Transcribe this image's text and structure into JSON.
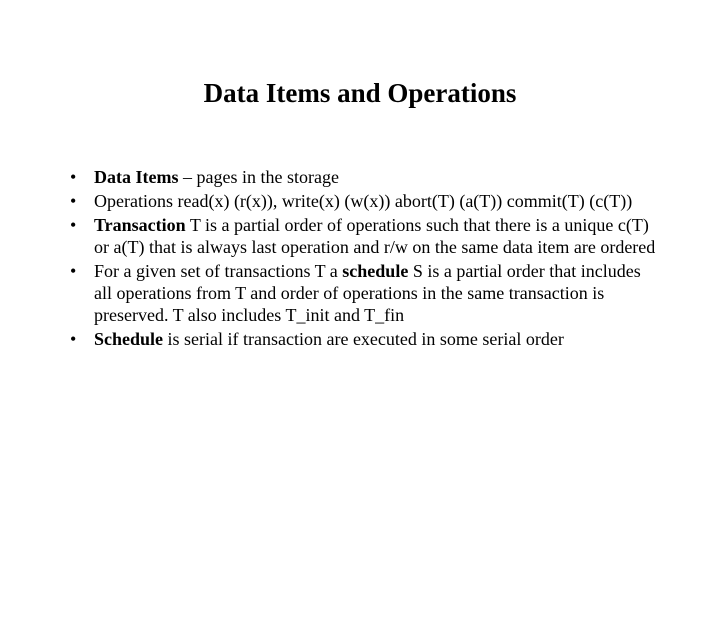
{
  "title": "Data Items and Operations",
  "bullets": [
    {
      "segments": [
        {
          "text": "Data Items",
          "bold": true
        },
        {
          "text": " – pages in the storage",
          "bold": false
        }
      ]
    },
    {
      "segments": [
        {
          "text": "Operations read(x) (r(x)), write(x) (w(x)) abort(T) (a(T)) commit(T) (c(T))",
          "bold": false
        }
      ]
    },
    {
      "segments": [
        {
          "text": "Transaction",
          "bold": true
        },
        {
          "text": " T is a partial order of operations such that there is a unique c(T) or a(T) that is always last operation and r/w on the same data item are ordered",
          "bold": false
        }
      ]
    },
    {
      "segments": [
        {
          "text": "For a given set of transactions T a ",
          "bold": false
        },
        {
          "text": "schedule",
          "bold": true
        },
        {
          "text": "  S  is a partial order that includes all operations from T and order of operations in the same transaction is preserved. T also includes T_init and T_fin",
          "bold": false
        }
      ]
    },
    {
      "segments": [
        {
          "text": "Schedule",
          "bold": true
        },
        {
          "text": " is serial if transaction are executed in some serial order",
          "bold": false
        }
      ]
    }
  ]
}
